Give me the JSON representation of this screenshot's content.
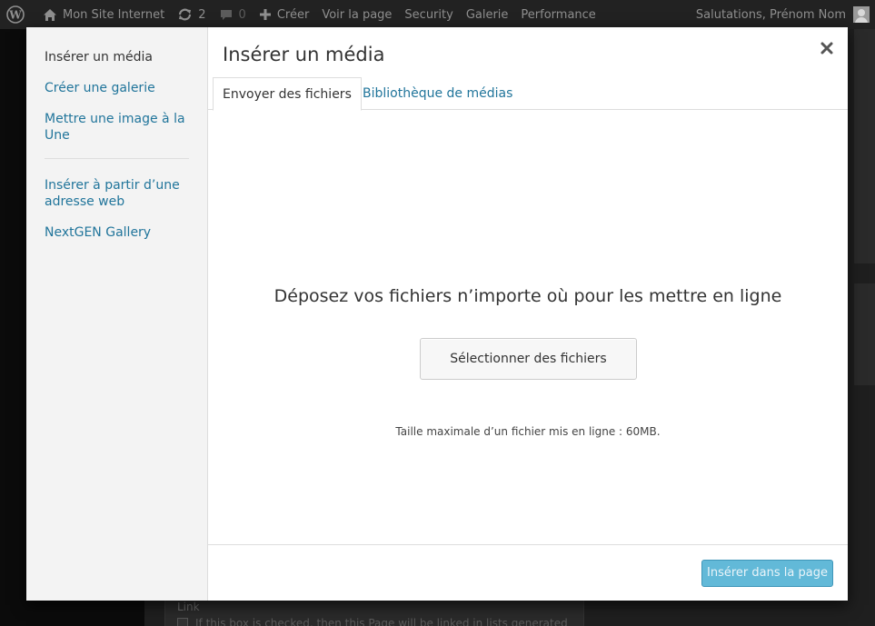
{
  "admin_bar": {
    "site_name": "Mon Site Internet",
    "updates_count": "2",
    "comments_count": "0",
    "create_label": "Créer",
    "view_page_label": "Voir la page",
    "security_label": "Security",
    "gallery_label": "Galerie",
    "performance_label": "Performance",
    "greeting": "Salutations, Prénom Nom"
  },
  "background": {
    "link_label": "Link",
    "checkbox_text": "If this box is checked, then this Page will be linked in lists generated"
  },
  "modal": {
    "title": "Insérer un média",
    "menu": {
      "items": [
        {
          "label": "Insérer un média",
          "active": true
        },
        {
          "label": "Créer une galerie",
          "active": false
        },
        {
          "label": "Mettre une image à la Une",
          "active": false
        }
      ],
      "items_after_separator": [
        {
          "label": "Insérer à partir d’une adresse web"
        },
        {
          "label": "NextGEN Gallery"
        }
      ]
    },
    "tabs": [
      {
        "label": "Envoyer des fichiers",
        "active": true
      },
      {
        "label": "Bibliothèque de médias",
        "active": false
      }
    ],
    "upload": {
      "instructions": "Déposez vos fichiers n’importe où pour les mettre en ligne",
      "select_button": "Sélectionner des fichiers",
      "max_size": "Taille maximale d’un fichier mis en ligne : 60MB."
    },
    "insert_button": "Insérer dans la page"
  },
  "colors": {
    "link": "#21759b",
    "primary_button": "#2ea2cc",
    "admin_bar": "#222222"
  }
}
